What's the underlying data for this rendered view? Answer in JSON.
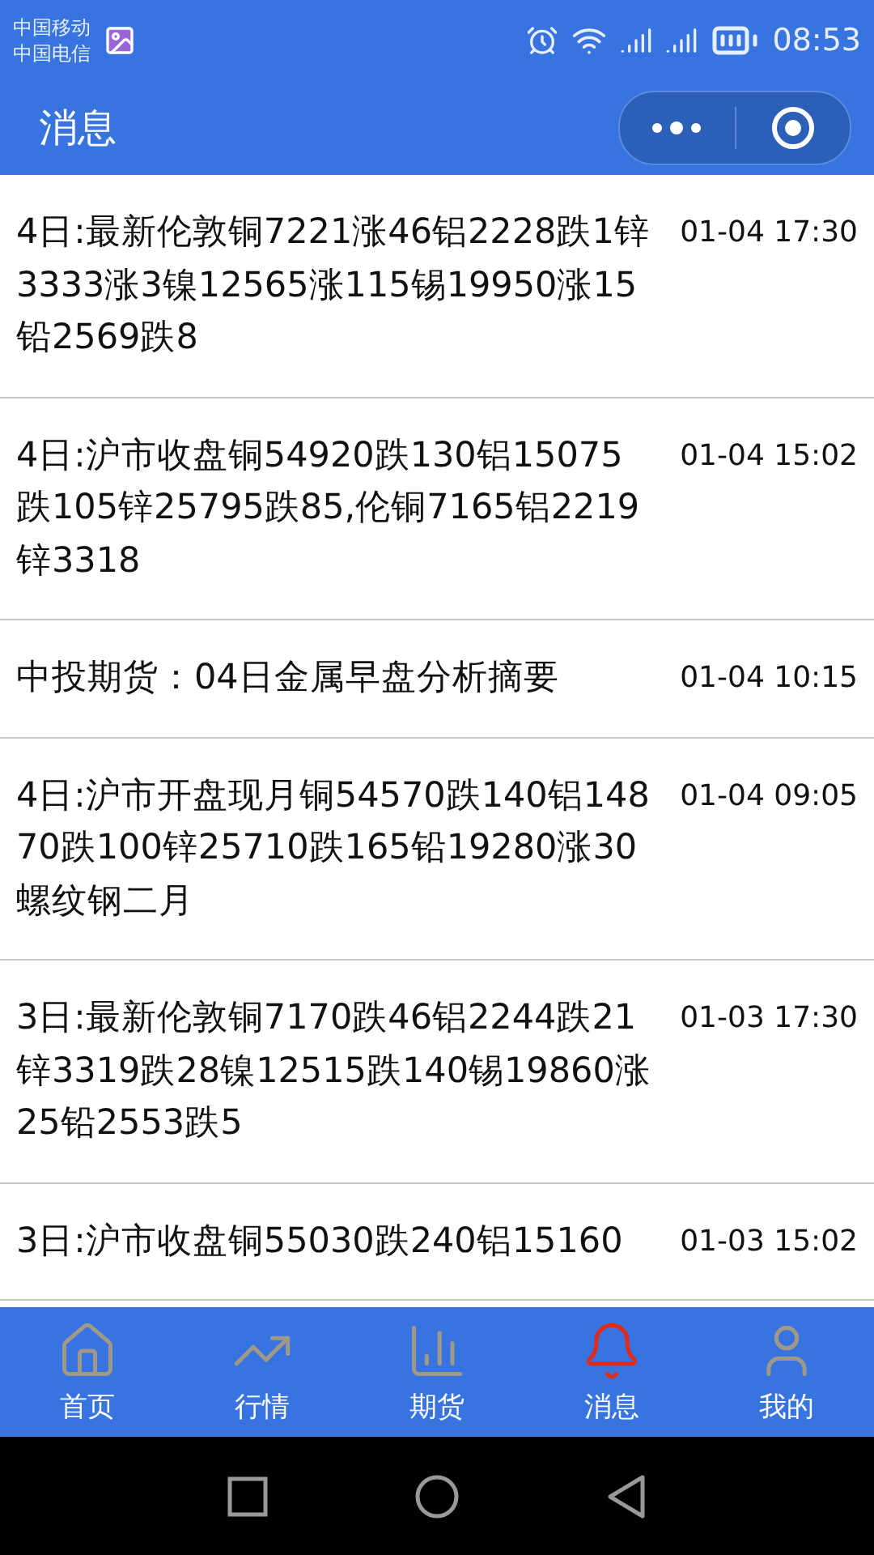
{
  "status_bar": {
    "carriers": [
      "中国移动",
      "中国电信"
    ],
    "time": "08:53"
  },
  "header": {
    "title": "消息"
  },
  "messages": [
    {
      "text": "4日:最新伦敦铜7221涨46铝2228跌1锌3333涨3镍12565涨115锡19950涨15铅2569跌8",
      "time": "01-04 17:30"
    },
    {
      "text": "4日:沪市收盘铜54920跌130铝15075跌105锌25795跌85,伦铜7165铝2219锌3318",
      "time": "01-04 15:02"
    },
    {
      "text": "中投期货：04日金属早盘分析摘要",
      "time": "01-04 10:15"
    },
    {
      "text": "4日:沪市开盘现月铜54570跌140铝14870跌100锌25710跌165铅19280涨30螺纹钢二月",
      "time": "01-04 09:05"
    },
    {
      "text": "3日:最新伦敦铜7170跌46铝2244跌21锌3319跌28镍12515跌140锡19860涨25铅2553跌5",
      "time": "01-03 17:30"
    },
    {
      "text": "3日:沪市收盘铜55030跌240铝15160",
      "time": "01-03 15:02"
    }
  ],
  "tabs": [
    {
      "label": "首页",
      "kind": "home",
      "selected": false
    },
    {
      "label": "行情",
      "kind": "trend",
      "selected": false
    },
    {
      "label": "期货",
      "kind": "chart",
      "selected": false
    },
    {
      "label": "消息",
      "kind": "bell",
      "selected": true
    },
    {
      "label": "我的",
      "kind": "user",
      "selected": false
    }
  ]
}
